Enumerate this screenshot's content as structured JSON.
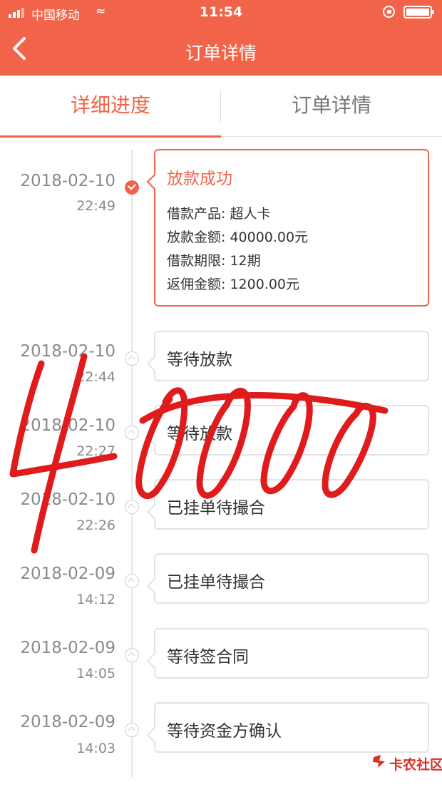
{
  "status_bar": {
    "carrier": "中国移动",
    "time": "11:54"
  },
  "header": {
    "title": "订单详情"
  },
  "tabs": [
    {
      "label": "详细进度",
      "active": true
    },
    {
      "label": "订单详情",
      "active": false
    }
  ],
  "timeline": [
    {
      "date": "2018-02-10",
      "time": "22:49",
      "status": "放款成功",
      "done": true,
      "details": [
        "借款产品: 超人卡",
        "放款金额: 40000.00元",
        "借款期限: 12期",
        "返佣金额: 1200.00元"
      ]
    },
    {
      "date": "2018-02-10",
      "time": "22:44",
      "status": "等待放款",
      "done": false
    },
    {
      "date": "2018-02-10",
      "time": "22:27",
      "status": "等待放款",
      "done": false
    },
    {
      "date": "2018-02-10",
      "time": "22:26",
      "status": "已挂单待撮合",
      "done": false
    },
    {
      "date": "2018-02-09",
      "time": "14:12",
      "status": "已挂单待撮合",
      "done": false
    },
    {
      "date": "2018-02-09",
      "time": "14:05",
      "status": "等待签合同",
      "done": false
    },
    {
      "date": "2018-02-09",
      "time": "14:03",
      "status": "等待资金方确认",
      "done": false
    }
  ],
  "handwriting": "40000",
  "watermark": "卡农社区",
  "colors": {
    "accent": "#f2644a",
    "ink": "#e01b1b",
    "muted": "#8a8a8a"
  },
  "icons": {
    "back": "chevron-left-icon",
    "done": "check-circle-icon",
    "pending": "chevron-up-circle-icon"
  }
}
